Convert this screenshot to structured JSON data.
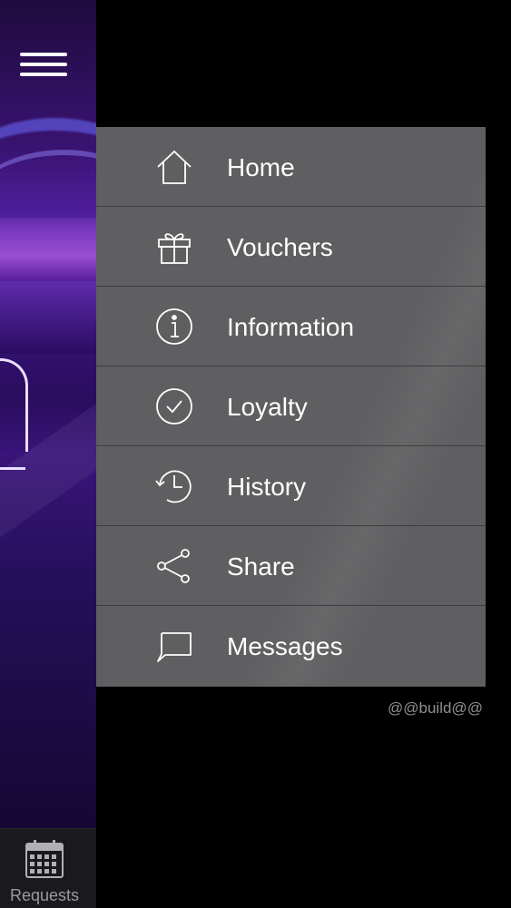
{
  "menu": {
    "items": [
      {
        "label": "Home",
        "icon": "home-icon"
      },
      {
        "label": "Vouchers",
        "icon": "gift-icon"
      },
      {
        "label": "Information",
        "icon": "info-icon"
      },
      {
        "label": "Loyalty",
        "icon": "check-circle-icon"
      },
      {
        "label": "History",
        "icon": "history-icon"
      },
      {
        "label": "Share",
        "icon": "share-icon"
      },
      {
        "label": "Messages",
        "icon": "message-icon"
      }
    ]
  },
  "footer": {
    "build_label": "@@build@@"
  },
  "bottom_tab": {
    "label": "Requests",
    "icon": "calendar-icon"
  },
  "colors": {
    "menu_bg": "#5f5f61",
    "divider": "#3e3e40",
    "background": "#000000",
    "accent": "#5522a8"
  }
}
